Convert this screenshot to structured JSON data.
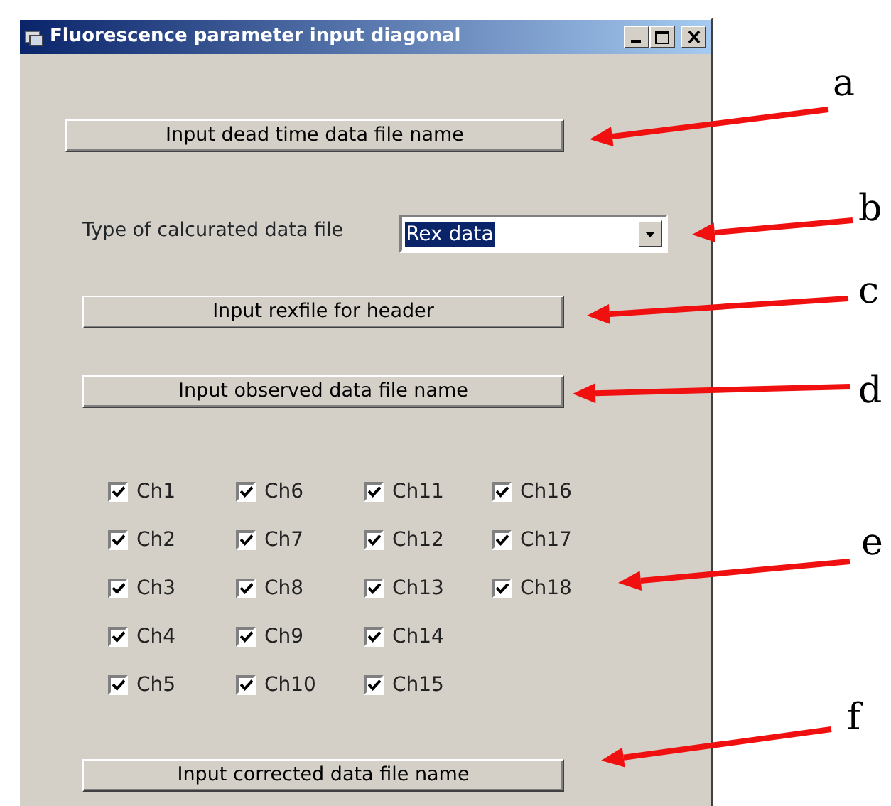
{
  "window": {
    "title": "Fluorescence parameter input diagonal"
  },
  "dead_time_button": {
    "label": "Input dead time data file name"
  },
  "data_type": {
    "label": "Type of calcurated data file",
    "value": "Rex data",
    "selected": true
  },
  "header_button": {
    "label": "Input rexfile for header"
  },
  "observed_button": {
    "label": "Input observed data file name"
  },
  "channels": [
    {
      "label": "Ch1",
      "checked": true
    },
    {
      "label": "Ch2",
      "checked": true
    },
    {
      "label": "Ch3",
      "checked": true
    },
    {
      "label": "Ch4",
      "checked": true
    },
    {
      "label": "Ch5",
      "checked": true
    },
    {
      "label": "Ch6",
      "checked": true
    },
    {
      "label": "Ch7",
      "checked": true
    },
    {
      "label": "Ch8",
      "checked": true
    },
    {
      "label": "Ch9",
      "checked": true
    },
    {
      "label": "Ch10",
      "checked": true
    },
    {
      "label": "Ch11",
      "checked": true
    },
    {
      "label": "Ch12",
      "checked": true
    },
    {
      "label": "Ch13",
      "checked": true
    },
    {
      "label": "Ch14",
      "checked": true
    },
    {
      "label": "Ch15",
      "checked": true
    },
    {
      "label": "Ch16",
      "checked": true
    },
    {
      "label": "Ch17",
      "checked": true
    },
    {
      "label": "Ch18",
      "checked": true
    }
  ],
  "corrected_button": {
    "label": "Input corrected data file name"
  },
  "annotations": [
    {
      "label": "a"
    },
    {
      "label": "b"
    },
    {
      "label": "c"
    },
    {
      "label": "d"
    },
    {
      "label": "e"
    },
    {
      "label": "f"
    }
  ]
}
